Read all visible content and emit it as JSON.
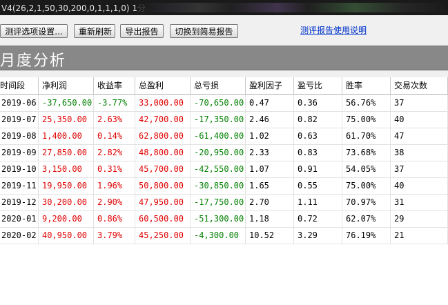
{
  "window": {
    "title": "V4(26,2,1,50,30,200,0,1,1,1,0) 1分"
  },
  "toolbar": {
    "eval_settings": "测评选项设置...",
    "refresh": "重新刷新",
    "export": "导出报告",
    "switch_simple": "切换到简易报告",
    "help_link": "测评报告使用说明"
  },
  "banner": {
    "title": "月度分析"
  },
  "table": {
    "headers": [
      "时间段",
      "净利润",
      "收益率",
      "总盈利",
      "总亏损",
      "盈利因子",
      "盈亏比",
      "胜率",
      "交易次数"
    ],
    "rows": [
      [
        "2019-06",
        "-37,650.00",
        "-3.77%",
        "33,000.00",
        "-70,650.00",
        "0.47",
        "0.36",
        "56.76%",
        "37"
      ],
      [
        "2019-07",
        "25,350.00",
        "2.63%",
        "42,700.00",
        "-17,350.00",
        "2.46",
        "0.82",
        "75.00%",
        "40"
      ],
      [
        "2019-08",
        "1,400.00",
        "0.14%",
        "62,800.00",
        "-61,400.00",
        "1.02",
        "0.63",
        "61.70%",
        "47"
      ],
      [
        "2019-09",
        "27,850.00",
        "2.82%",
        "48,800.00",
        "-20,950.00",
        "2.33",
        "0.83",
        "73.68%",
        "38"
      ],
      [
        "2019-10",
        "3,150.00",
        "0.31%",
        "45,700.00",
        "-42,550.00",
        "1.07",
        "0.91",
        "54.05%",
        "37"
      ],
      [
        "2019-11",
        "19,950.00",
        "1.96%",
        "50,800.00",
        "-30,850.00",
        "1.65",
        "0.55",
        "75.00%",
        "40"
      ],
      [
        "2019-12",
        "30,200.00",
        "2.90%",
        "47,950.00",
        "-17,750.00",
        "2.70",
        "1.11",
        "70.97%",
        "31"
      ],
      [
        "2020-01",
        "9,200.00",
        "0.86%",
        "60,500.00",
        "-51,300.00",
        "1.18",
        "0.72",
        "62.07%",
        "29"
      ],
      [
        "2020-02",
        "40,950.00",
        "3.79%",
        "45,250.00",
        "-4,300.00",
        "10.52",
        "3.29",
        "76.19%",
        "21"
      ]
    ]
  },
  "colors": {
    "positive": "#e00000",
    "negative": "#008000",
    "banner_bg": "#888888"
  }
}
